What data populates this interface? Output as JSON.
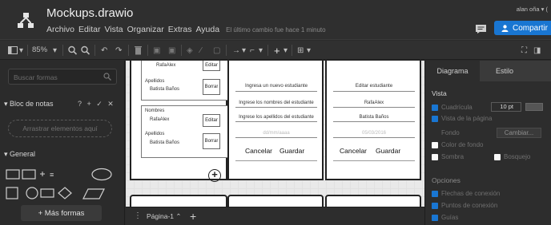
{
  "header": {
    "file_title": "Mockups.drawio",
    "menu": [
      "Archivo",
      "Editar",
      "Vista",
      "Organizar",
      "Extras",
      "Ayuda"
    ],
    "last_change": "El último cambio fue hace 1 minuto",
    "user": "alan oña ▾ (",
    "share_label": "Compartir"
  },
  "toolbar": {
    "zoom": "85%"
  },
  "left_panel": {
    "search_placeholder": "Buscar formas",
    "notepad_title": "▾ Bloc de notas",
    "notepad_actions": "? + ✓ ✕",
    "drop_hint": "Arrastrar elementos aquí",
    "general_title": "▾ General",
    "more_shapes": "+ Más formas"
  },
  "canvas": {
    "card1": {
      "name": "RafaAlex",
      "edit": "Editar",
      "surname_label": "Apellidos",
      "surname": "Batista Baños",
      "delete": "Borrar"
    },
    "card2": {
      "name_label": "Nombres",
      "name": "RafaAlex",
      "edit": "Editar",
      "surname_label": "Apellidos",
      "surname": "Batista Baños",
      "delete": "Borrar"
    },
    "add_symbol": "+",
    "new_form": {
      "title": "Ingresa un nuevo estudiante",
      "names": "Ingrese los nombres del estudiante",
      "surnames": "Ingrese los apellidos del estudiante",
      "date": "dd/mm/aaaa",
      "cancel": "Cancelar",
      "save": "Guardar"
    },
    "edit_form": {
      "title": "Editar estudiante",
      "name": "RafaAlex",
      "surname": "Batista Baños",
      "date": "05/03/2016",
      "cancel": "Cancelar",
      "save": "Guardar"
    }
  },
  "page_bar": {
    "tab": "Página-1 ⌃",
    "add": "+"
  },
  "right_panel": {
    "tabs": [
      "Diagrama",
      "Estilo",
      ""
    ],
    "view_title": "Vista",
    "grid_label": "Cuadrícula",
    "grid_size": "10 pt",
    "page_view": "Vista de la página",
    "background_label": "Fondo",
    "change_label": "Cambiar...",
    "bg_color": "Color de fondo",
    "shadow": "Sombra",
    "sketch": "Bosquejo",
    "options_title": "Opciones",
    "connection_arrows": "Flechas de conexión",
    "connection_points": "Puntos de conexión",
    "guides": "Guías"
  },
  "colors": {
    "accent": "#1976d2",
    "panel": "#2b2b2b",
    "canvas": "#e9e9e9"
  }
}
